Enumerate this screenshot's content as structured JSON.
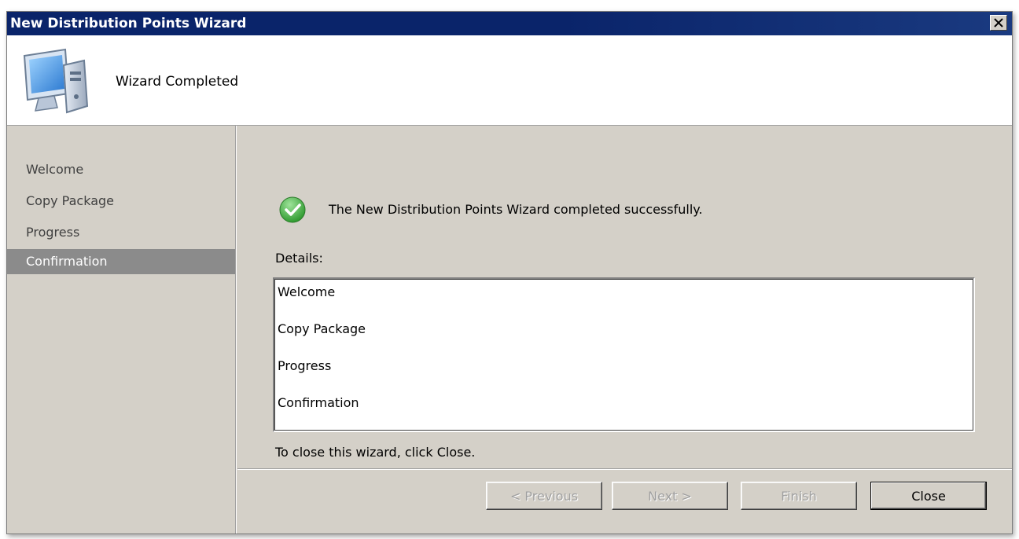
{
  "window": {
    "title": "New Distribution Points Wizard",
    "close_glyph": "✕"
  },
  "header": {
    "icon": "computer-icon",
    "title": "Wizard Completed"
  },
  "nav": {
    "items": [
      {
        "label": "Welcome",
        "active": false
      },
      {
        "label": "Copy Package",
        "active": false
      },
      {
        "label": "Progress",
        "active": false
      },
      {
        "label": "Confirmation",
        "active": true
      }
    ]
  },
  "content": {
    "status_icon": "success-check-icon",
    "status_message": "The New Distribution Points Wizard completed successfully.",
    "details_label": "Details:",
    "details_lines": [
      "Welcome",
      "Copy Package",
      "Progress",
      "Confirmation"
    ],
    "close_hint": "To close this wizard, click Close."
  },
  "buttons": {
    "previous": {
      "label": "< Previous",
      "enabled": false
    },
    "next": {
      "label": "Next >",
      "enabled": false
    },
    "finish": {
      "label": "Finish",
      "enabled": false
    },
    "close": {
      "label": "Close",
      "enabled": true
    }
  },
  "colors": {
    "titlebar": "#0a246a",
    "face": "#d4d0c8",
    "nav_active": "#8b8b8b",
    "success": "#3ea83e"
  }
}
